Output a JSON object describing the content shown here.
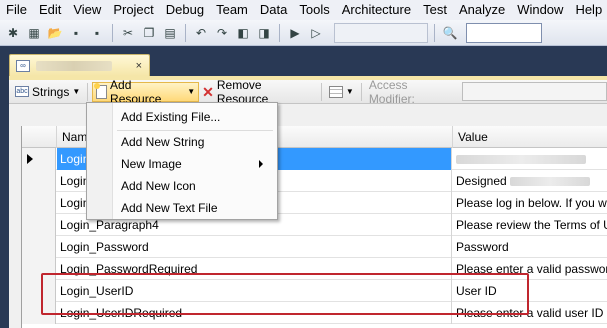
{
  "menubar": {
    "items": [
      "File",
      "Edit",
      "View",
      "Project",
      "Debug",
      "Team",
      "Data",
      "Tools",
      "Architecture",
      "Test",
      "Analyze",
      "Window",
      "Help"
    ]
  },
  "editor_toolbar": {
    "strings_label": "Strings",
    "add_resource_label": "Add Resource",
    "remove_resource_label": "Remove Resource",
    "access_modifier_label": "Access Modifier:"
  },
  "dropdown": {
    "items": [
      "Add Existing File...",
      "Add New String",
      "New Image",
      "Add New Icon",
      "Add New Text File"
    ]
  },
  "grid": {
    "headers": {
      "name": "Name",
      "value": "Value"
    },
    "rows": [
      {
        "name": "Login",
        "value": ""
      },
      {
        "name": "Login",
        "value": "Designed"
      },
      {
        "name": "Login",
        "value": "Please log in below. If you wo"
      },
      {
        "name": "Login_Paragraph4",
        "value": "Please review the Terms of Us"
      },
      {
        "name": "Login_Password",
        "value": "Password"
      },
      {
        "name": "Login_PasswordRequired",
        "value": "Please enter a valid password"
      },
      {
        "name": "Login_UserID",
        "value": "User ID"
      },
      {
        "name": "Login_UserIDRequired",
        "value": "Please enter a valid user ID"
      }
    ]
  },
  "colors": {
    "highlight_border": "#c0262e",
    "selected_row": "#3399ff",
    "active_button": "#ffd97a"
  }
}
